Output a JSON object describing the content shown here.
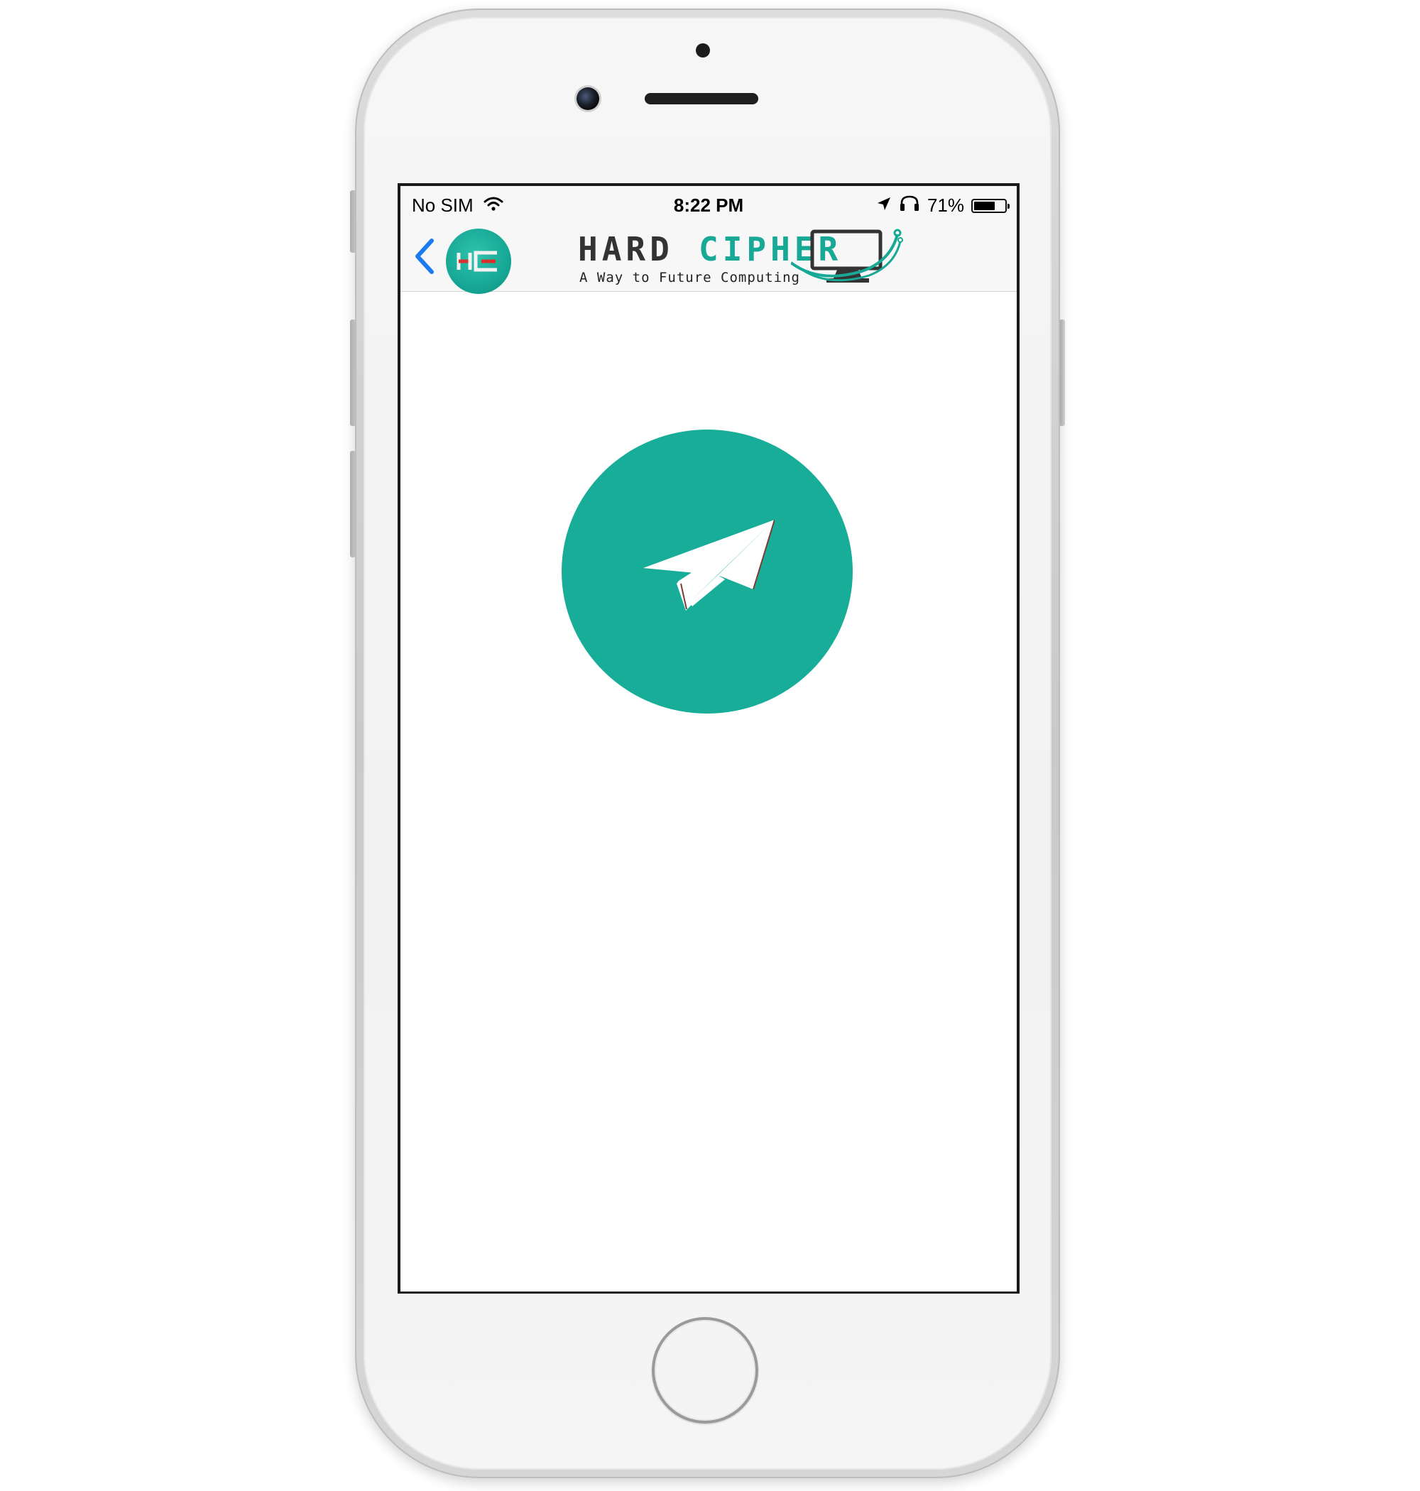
{
  "status_bar": {
    "carrier": "No SIM",
    "time": "8:22 PM",
    "battery_percent_label": "71%",
    "battery_level": 0.71,
    "icons": [
      "wifi-icon",
      "location-arrow-icon",
      "headphones-icon",
      "battery-icon"
    ]
  },
  "nav_bar": {
    "back_icon": "chevron-left-icon",
    "avatar_icon": "hc-logo-icon",
    "brand": {
      "word_one": "HARD",
      "word_two": "CIPHER",
      "tagline": "A Way to Future Computing"
    }
  },
  "main": {
    "action_icon": "paper-plane-icon"
  },
  "colors": {
    "accent": "#18ad99",
    "back_chevron": "#1a7cf0",
    "brand_red": "#d9312b",
    "brand_dark": "#333333",
    "status_bar_bg": "#f7f7f7"
  }
}
